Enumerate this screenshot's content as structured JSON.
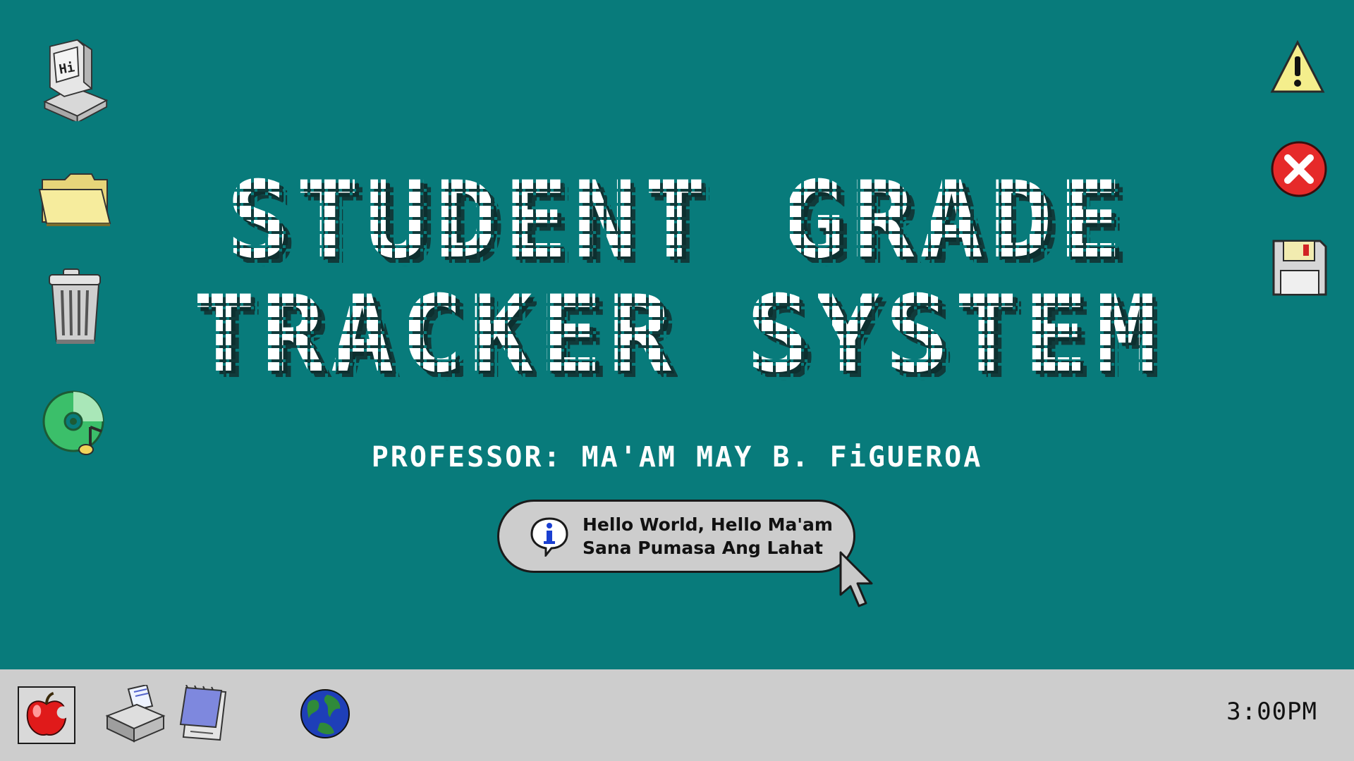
{
  "desktop": {
    "background_color": "#087b7b",
    "left_icons": [
      {
        "name": "my-computer-icon",
        "label": "Hi"
      },
      {
        "name": "folder-icon"
      },
      {
        "name": "recycle-bin-icon"
      },
      {
        "name": "cd-music-icon"
      }
    ],
    "right_icons": [
      {
        "name": "warning-icon"
      },
      {
        "name": "error-close-icon"
      },
      {
        "name": "floppy-disk-icon"
      }
    ]
  },
  "title": {
    "line1": "STUDENT GRADE",
    "line2": "TRACKER SYSTEM"
  },
  "professor": "PROFESSOR: MA'AM MAY B. FiGUEROA",
  "tooltip": {
    "icon": "info-icon",
    "line1": "Hello World, Hello Ma'am",
    "line2": "Sana Pumasa Ang Lahat"
  },
  "taskbar": {
    "background_color": "#cdcdcd",
    "items": [
      {
        "name": "apple-start-icon"
      },
      {
        "name": "printer-icon"
      },
      {
        "name": "notepad-icon"
      },
      {
        "name": "globe-icon"
      }
    ],
    "clock": "3:00PM"
  }
}
